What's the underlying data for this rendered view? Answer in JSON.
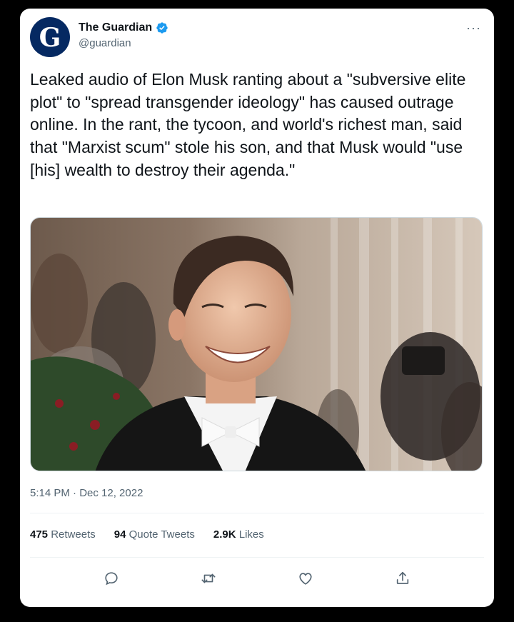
{
  "author": {
    "display_name": "The Guardian",
    "handle": "@guardian",
    "avatar_letter": "G",
    "avatar_color": "#052962",
    "verified_color": "#1d9bf0"
  },
  "more_icon": "···",
  "tweet": {
    "text": "Leaked audio of Elon Musk ranting about a \"subversive elite plot\" to \"spread transgender ideology\" has caused outrage online. In the rant, the tycoon, and world's richest man, said that \"Marxist scum\" stole his son, and that Musk would \"use [his] wealth to destroy their agenda.\"",
    "timestamp": "5:14 PM · Dec 12, 2022"
  },
  "stats": {
    "retweets_count": "475",
    "retweets_label": "Retweets",
    "quotes_count": "94",
    "quotes_label": "Quote Tweets",
    "likes_count": "2.9K",
    "likes_label": "Likes"
  },
  "actions": [
    "reply-icon",
    "retweet-icon",
    "like-icon",
    "share-icon"
  ],
  "colors": {
    "icon_gray": "#536471",
    "text": "#0f1419"
  }
}
